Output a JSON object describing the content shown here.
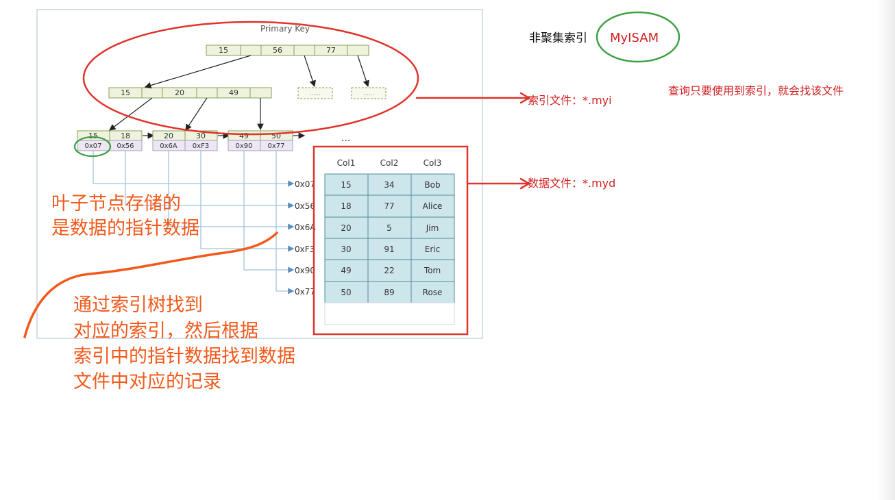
{
  "diagram": {
    "title": "Primary Key",
    "root_keys": [
      "15",
      "56",
      "77"
    ],
    "mid_keys": [
      "15",
      "20",
      "49"
    ],
    "placeholder_dots": "......",
    "leaf_nodes": [
      {
        "keys": [
          "15",
          "18"
        ],
        "pointers": [
          "0x07",
          "0x56"
        ]
      },
      {
        "keys": [
          "20",
          "30"
        ],
        "pointers": [
          "0x6A",
          "0xF3"
        ]
      },
      {
        "keys": [
          "49",
          "50"
        ],
        "pointers": [
          "0x90",
          "0x77"
        ]
      }
    ],
    "leaf_more": "...",
    "pointer_targets": [
      "0x07",
      "0x56",
      "0x6A",
      "0xF3",
      "0x90",
      "0x77"
    ],
    "table": {
      "headers": [
        "Col1",
        "Col2",
        "Col3"
      ],
      "rows": [
        [
          "15",
          "34",
          "Bob"
        ],
        [
          "18",
          "77",
          "Alice"
        ],
        [
          "20",
          "5",
          "Jim"
        ],
        [
          "30",
          "91",
          "Eric"
        ],
        [
          "49",
          "22",
          "Tom"
        ],
        [
          "50",
          "89",
          "Rose"
        ]
      ]
    }
  },
  "notes": {
    "non_clustered_label": "非聚集索引",
    "engine": "MyISAM",
    "index_file": "索引文件：*.myi",
    "data_file": "数据文件：*.myd",
    "query_note": "查询只要使用到索引，就会找该文件",
    "leaf_note": [
      "叶子节点存储的",
      "是数据的指针数据"
    ],
    "lookup_note": [
      "通过索引树找到",
      "对应的索引，然后根据",
      "索引中的指针数据找到数据",
      "文件中对应的记录"
    ]
  },
  "colors": {
    "node_fill": "#eef3dd",
    "node_border": "#8a9e58",
    "pointer_fill": "#ece7f3",
    "pointer_border": "#a99bbf",
    "table_fill": "#cde6ec",
    "table_border": "#4f8c99",
    "connector": "#9fc3dd",
    "annotation_red": "#e0332b",
    "text_red": "#d11f1f",
    "handwriting_orange": "#f2591b",
    "circle_green": "#3fa043"
  }
}
